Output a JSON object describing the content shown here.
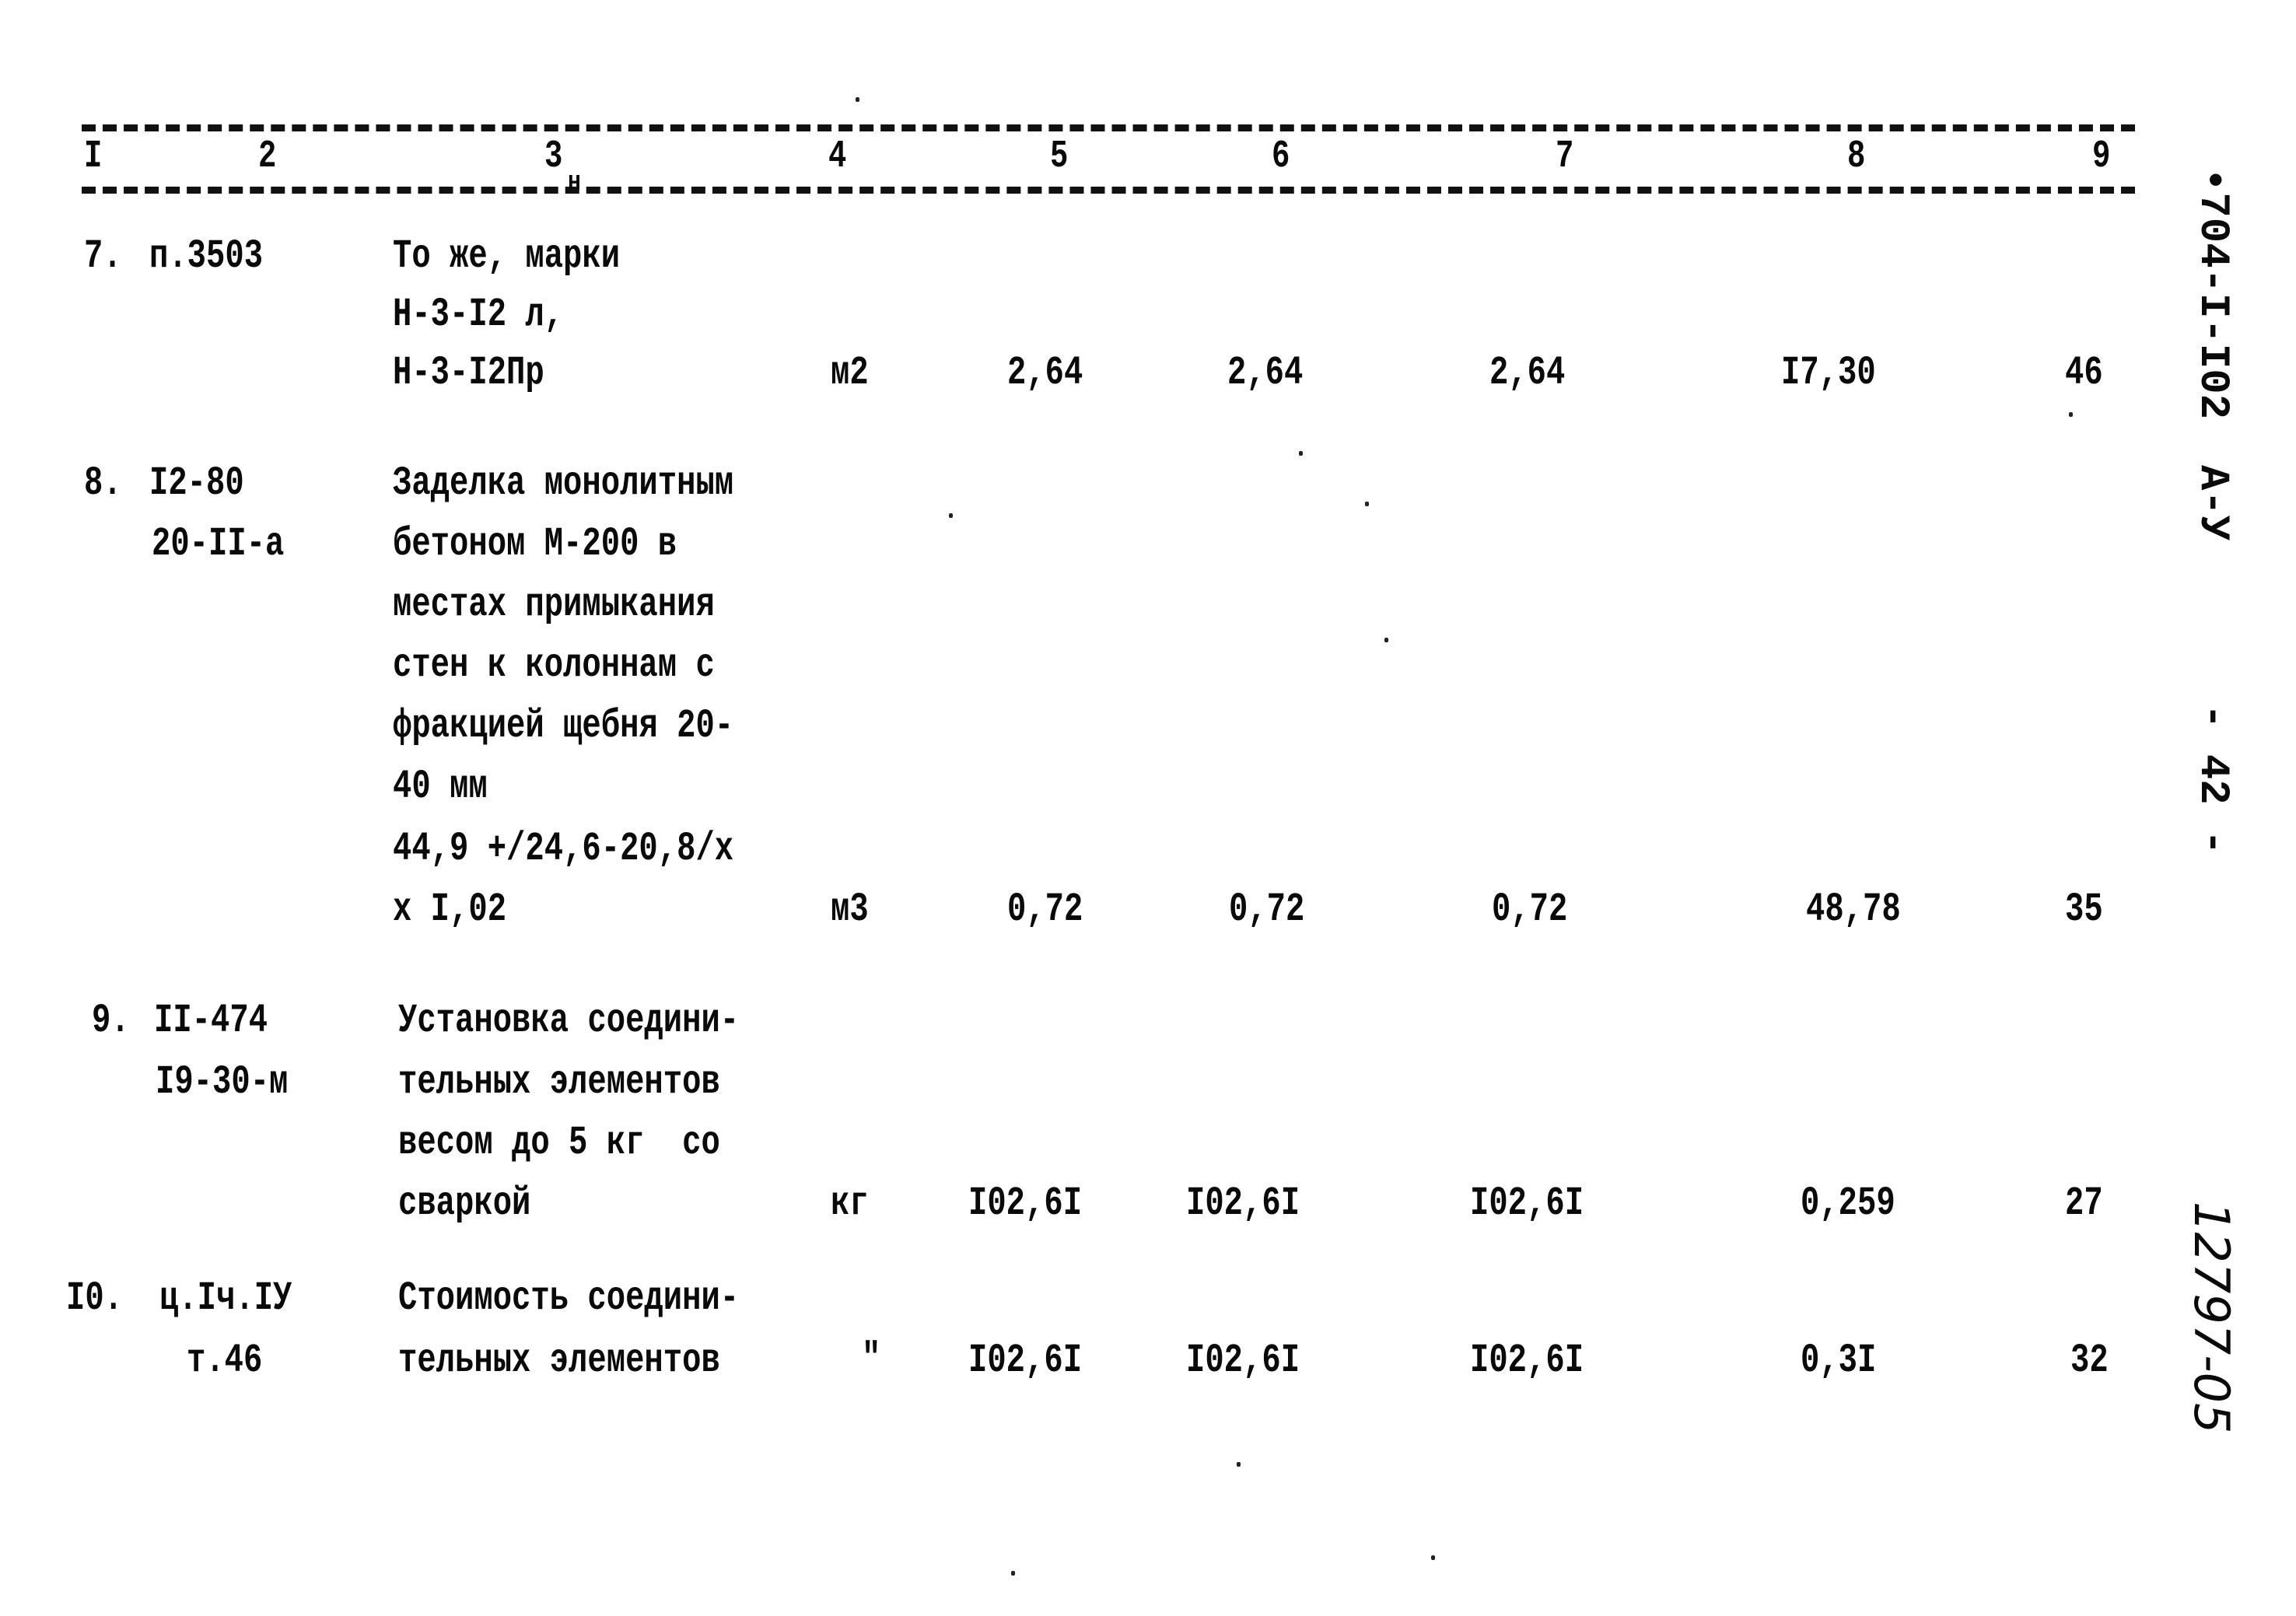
{
  "table": {
    "header": [
      "I",
      "2",
      "3",
      "4",
      "5",
      "6",
      "7",
      "8",
      "9"
    ],
    "header_note": "н",
    "rows": [
      {
        "index": "7.",
        "code": [
          "п.3503"
        ],
        "description": [
          "То же, марки",
          "Н-3-I2 л,",
          "Н-3-I2Пр"
        ],
        "unit": "м2",
        "col5": "2,64",
        "col6": "2,64",
        "col7": "2,64",
        "col8": "I7,30",
        "col9": "46"
      },
      {
        "index": "8.",
        "code": [
          "I2-80",
          "20-II-а"
        ],
        "description": [
          "Заделка монолитным",
          "бетоном М-200 в",
          "местах примыкания",
          "стен к колоннам с",
          "фракцией щебня 20-",
          "40 мм",
          "44,9 +/24,6-20,8/х",
          "х I,02"
        ],
        "unit": "м3",
        "col5": "0,72",
        "col6": "0,72",
        "col7": "0,72",
        "col8": "48,78",
        "col9": "35"
      },
      {
        "index": "9.",
        "code": [
          "II-474",
          "I9-30-м"
        ],
        "description": [
          "Установка соедини-",
          "тельных элементов",
          "весом до 5 кг  со",
          "сваркой"
        ],
        "unit": "кг",
        "col5": "I02,6I",
        "col6": "I02,6I",
        "col7": "I02,6I",
        "col8": "0,259",
        "col9": "27"
      },
      {
        "index": "I0.",
        "code": [
          "ц.Iч.IУ",
          "т.46"
        ],
        "description": [
          "Стоимость соедини-",
          "тельных элементов"
        ],
        "unit": "\"",
        "col5": "I02,6I",
        "col6": "I02,6I",
        "col7": "I02,6I",
        "col8": "0,3I",
        "col9": "32"
      }
    ]
  },
  "margin": {
    "doc_code": "•704-I-I02",
    "sheet_type": "А-У",
    "page_number": "- 42 -",
    "handwritten_number": "12797-05"
  }
}
